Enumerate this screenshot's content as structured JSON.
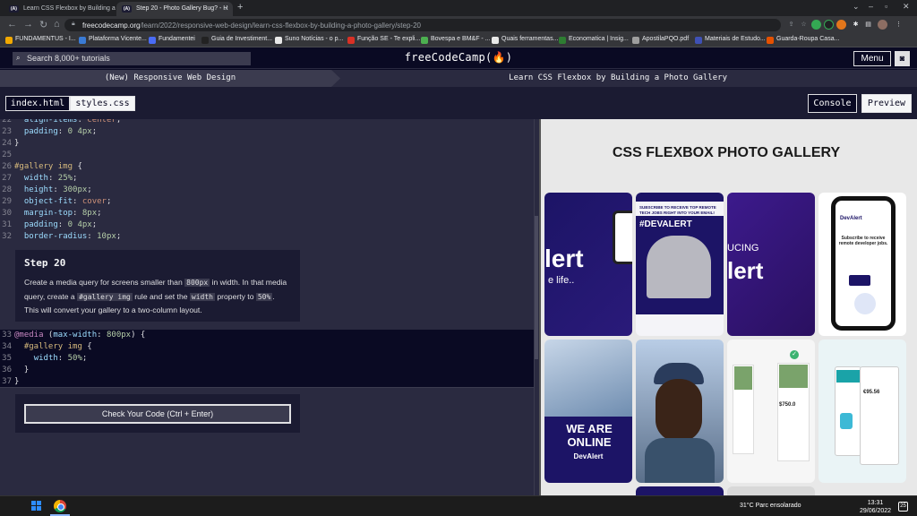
{
  "browser": {
    "tabs": [
      {
        "favicon": "(A)",
        "title": "Learn CSS Flexbox by Building a"
      },
      {
        "favicon": "(A)",
        "title": "Step 20 - Photo Gallery Bug? - H"
      }
    ],
    "url_host": "freecodecamp.org",
    "url_path": "/learn/2022/responsive-web-design/learn-css-flexbox-by-building-a-photo-gallery/step-20",
    "bookmarks": [
      {
        "label": "FUNDAMENTUS - I...",
        "color": "#f2a900"
      },
      {
        "label": "Plataforma Vicente...",
        "color": "#3a7bd5"
      },
      {
        "label": "Fundamentei",
        "color": "#4a6cf7"
      },
      {
        "label": "Guia de Investiment...",
        "color": "#222222"
      },
      {
        "label": "Suno Notícias - o p...",
        "color": "#e8e8e8"
      },
      {
        "label": "Função SE - Te expli...",
        "color": "#d93025"
      },
      {
        "label": "Bovespa e BM&F - ...",
        "color": "#4caf50"
      },
      {
        "label": "Quais ferramentas...",
        "color": "#e8e8e8"
      },
      {
        "label": "Economatica | Insig...",
        "color": "#2e7d32"
      },
      {
        "label": "ApostilaPQO.pdf",
        "color": "#9e9e9e"
      },
      {
        "label": "Materiais de Estudo...",
        "color": "#3f51b5"
      },
      {
        "label": "Guarda-Roupa Casa...",
        "color": "#e65100"
      }
    ]
  },
  "fcc": {
    "search_placeholder": "Search 8,000+ tutorials",
    "logo": "freeCodeCamp(🔥)",
    "menu_label": "Menu",
    "breadcrumb_course": "(New) Responsive Web Design",
    "breadcrumb_lesson": "Learn CSS Flexbox by Building a Photo Gallery"
  },
  "editor": {
    "file_tabs": [
      "index.html",
      "styles.css"
    ],
    "console_label": "Console",
    "preview_label": "Preview",
    "instructions": {
      "title": "Step 20",
      "text_1": "Create a media query for screens smaller than ",
      "code_1": "800px",
      "text_2": " in width. In that media query, create a ",
      "code_2": "#gallery img",
      "text_3": " rule and set the ",
      "code_3": "width",
      "text_4": " property to ",
      "code_4": "50%",
      "text_5": ". This will convert your gallery to a two-column layout."
    },
    "check_button": "Check Your Code (Ctrl + Enter)"
  },
  "preview": {
    "title": "CSS FLEXBOX PHOTO GALLERY",
    "photos": [
      {
        "caption": "lert",
        "sub": "e life..",
        "bg": "#1c1466"
      },
      {
        "caption": "#DEVALERT",
        "sub": "SUBSCRIBE TO RECEIVE TOP REMOTE TECH JOBS RIGHT INTO YOUR EMAIL!",
        "bg": "#f4f4f8"
      },
      {
        "caption": "lert",
        "sub": "UCING",
        "bg": "#3c1a8c"
      },
      {
        "caption": "DevAlert",
        "sub": "Subscribe to receive remote developer jobs.",
        "bg": "#ffffff"
      },
      {
        "caption": "WE ARE ONLINE",
        "sub": "DevAlert",
        "bg": "#ffffff"
      },
      {
        "caption": "",
        "sub": "",
        "bg": "#7a9cc9"
      },
      {
        "caption": "$750.0",
        "sub": "",
        "bg": "#f6f6f6"
      },
      {
        "caption": "€95.56",
        "sub": "",
        "bg": "#eaf4f6"
      }
    ]
  },
  "taskbar": {
    "weather": "31°C  Parc ensolarado",
    "time": "13:31",
    "date": "29/06/2022",
    "notifications": "25"
  },
  "colors": {
    "bg": "#0a0a23",
    "panel": "#1b1b32",
    "editor": "#2a2a40",
    "accent": "#f5f6f7"
  }
}
